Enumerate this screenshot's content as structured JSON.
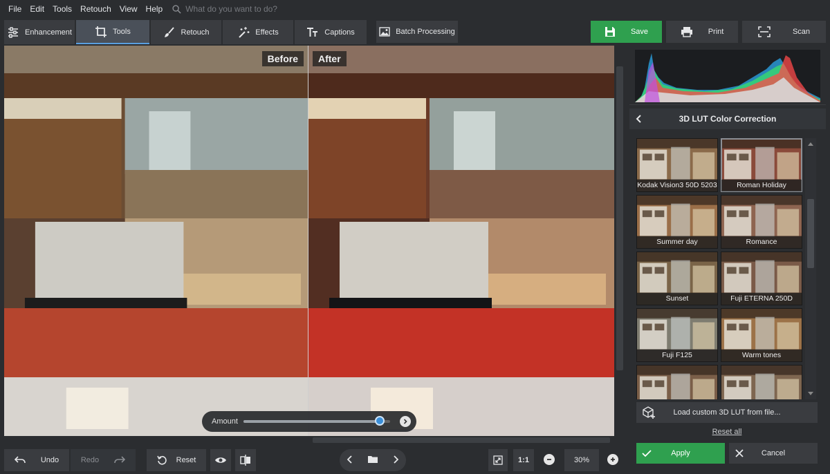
{
  "menu": {
    "items": [
      "File",
      "Edit",
      "Tools",
      "Retouch",
      "View",
      "Help"
    ],
    "search_placeholder": "What do you want to do?"
  },
  "toolbar": {
    "tabs": [
      {
        "label": "Enhancement",
        "icon": "sliders-icon"
      },
      {
        "label": "Tools",
        "icon": "crop-icon",
        "active": true
      },
      {
        "label": "Retouch",
        "icon": "brush-icon"
      },
      {
        "label": "Effects",
        "icon": "magic-wand-icon"
      },
      {
        "label": "Captions",
        "icon": "text-icon"
      }
    ],
    "batch_label": "Batch Processing",
    "save_label": "Save",
    "print_label": "Print",
    "scan_label": "Scan"
  },
  "viewer": {
    "before_label": "Before",
    "after_label": "After",
    "amount_label": "Amount",
    "amount_value": 0.93
  },
  "panel": {
    "title": "3D LUT Color Correction",
    "luts": [
      {
        "label": "Kodak Vision3 50D 5203",
        "tone": "#8a6a4a"
      },
      {
        "label": "Roman Holiday",
        "tone": "#8a4a3a",
        "selected": true
      },
      {
        "label": "Summer day",
        "tone": "#9a6e48"
      },
      {
        "label": "Romance",
        "tone": "#8e6450"
      },
      {
        "label": "Sunset",
        "tone": "#7a6448"
      },
      {
        "label": "Fuji ETERNA 250D",
        "tone": "#7a5a48"
      },
      {
        "label": "Fuji F125",
        "tone": "#7e7c70"
      },
      {
        "label": "Warm tones",
        "tone": "#9c7248"
      },
      {
        "label": "",
        "tone": "#7a5e48"
      },
      {
        "label": "",
        "tone": "#7e6650"
      }
    ],
    "load_label": "Load custom 3D LUT from file...",
    "reset_all_label": "Reset all",
    "apply_label": "Apply",
    "cancel_label": "Cancel"
  },
  "bottom": {
    "undo_label": "Undo",
    "redo_label": "Redo",
    "reset_label": "Reset",
    "zoom_one_label": "1:1",
    "zoom_value": "30%"
  },
  "colors": {
    "accent_green": "#2fa04f",
    "accent_blue": "#3b8fd8",
    "panel_bg": "#2b2d30"
  }
}
